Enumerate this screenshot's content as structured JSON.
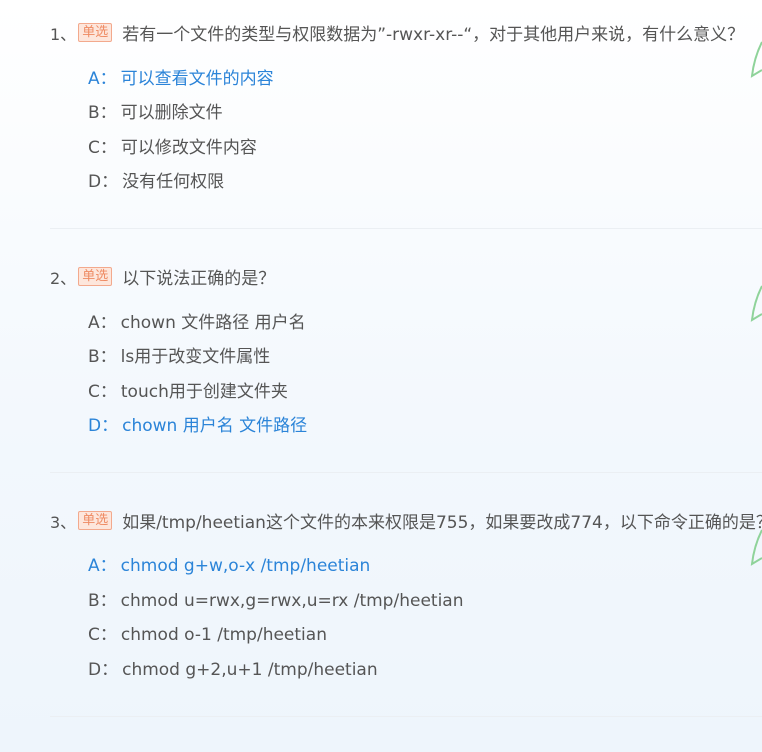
{
  "questions": [
    {
      "number": "1、",
      "type": "单选",
      "text": "若有一个文件的类型与权限数据为”-rwxr-xr--“，对于其他用户来说，有什么意义？",
      "options": [
        {
          "letter": "A：",
          "text": "可以查看文件的内容",
          "correct": true
        },
        {
          "letter": "B：",
          "text": "可以删除文件",
          "correct": false
        },
        {
          "letter": "C：",
          "text": "可以修改文件内容",
          "correct": false
        },
        {
          "letter": "D：",
          "text": "没有任何权限",
          "correct": false
        }
      ]
    },
    {
      "number": "2、",
      "type": "单选",
      "text": "以下说法正确的是？",
      "options": [
        {
          "letter": "A：",
          "text": "chown 文件路径 用户名",
          "correct": false
        },
        {
          "letter": "B：",
          "text": "ls用于改变文件属性",
          "correct": false
        },
        {
          "letter": "C：",
          "text": "touch用于创建文件夹",
          "correct": false
        },
        {
          "letter": "D：",
          "text": "chown 用户名 文件路径",
          "correct": true
        }
      ]
    },
    {
      "number": "3、",
      "type": "单选",
      "text": "如果/tmp/heetian这个文件的本来权限是755，如果要改成774，以下命令正确的是？",
      "options": [
        {
          "letter": "A：",
          "text": "chmod g+w,o-x /tmp/heetian",
          "correct": true
        },
        {
          "letter": "B：",
          "text": "chmod u=rwx,g=rwx,u=rx /tmp/heetian",
          "correct": false
        },
        {
          "letter": "C：",
          "text": "chmod o-1 /tmp/heetian",
          "correct": false
        },
        {
          "letter": "D：",
          "text": "chmod g+2,u+1 /tmp/heetian",
          "correct": false
        }
      ]
    }
  ],
  "colors": {
    "correct": "#2b84d8",
    "text": "#555555",
    "badge_bg": "#fde6dc",
    "badge_border": "#f3a98d",
    "badge_text": "#ee8a62",
    "check_mark": "#8fd39a"
  }
}
